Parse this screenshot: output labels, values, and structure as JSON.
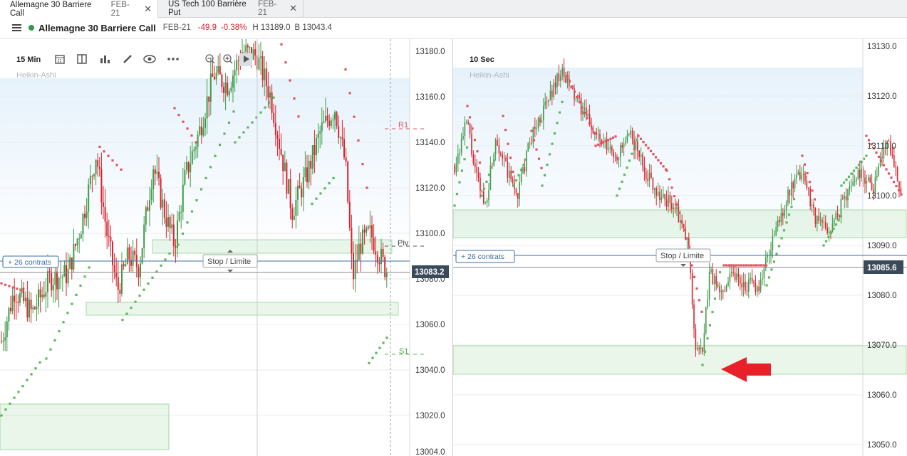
{
  "tabs": [
    {
      "name": "Allemagne 30 Barriere Call",
      "expiry": "FEB-21",
      "active": true
    },
    {
      "name": "US Tech 100 Barrière Put",
      "expiry": "FEB-21",
      "active": false
    }
  ],
  "toolbar": {
    "instrument": "Allemagne 30 Barriere Call",
    "expiry": "FEB-21",
    "change": "-49.9",
    "change_pct": "-0.38%",
    "high": "H 13189.0",
    "bid": "B 13043.4",
    "status_color": "#2e9b46"
  },
  "left_chart": {
    "timeframe": "15 Min",
    "chart_type": "Heikin-Ashi",
    "y_ticks": [
      "13180.0",
      "13160.0",
      "13140.0",
      "13120.0",
      "13100.0",
      "13080.0",
      "13060.0",
      "13040.0",
      "13020.0",
      "13004.0"
    ],
    "current_price": "13083.2",
    "position_label": "+ 26 contrats",
    "stop_label": "Stop / Limite",
    "pivot_labels": {
      "r1": "R1",
      "piv": "Piv",
      "s1": "S1"
    },
    "icons": [
      "calendar-icon",
      "layout-icon",
      "bar-chart-icon",
      "pencil-icon",
      "eye-icon",
      "more-icon",
      "zoom-out-icon",
      "zoom-in-icon",
      "play-icon"
    ]
  },
  "right_chart": {
    "timeframe": "10 Sec",
    "chart_type": "Heikin-Ashi",
    "y_ticks": [
      "13130.0",
      "13120.0",
      "13110.0",
      "13100.0",
      "13090.0",
      "13080.0",
      "13070.0",
      "13060.0",
      "13050.0"
    ],
    "current_price": "13085.6",
    "position_label": "+ 26 contrats",
    "stop_label": "Stop / Limite"
  },
  "colors": {
    "up": "#3f9a48",
    "down": "#d9232f",
    "sar_up": "#5cb85c",
    "sar_down": "#e05560",
    "price_tag": "#3b4a5a",
    "position": "#3a6ea5"
  }
}
